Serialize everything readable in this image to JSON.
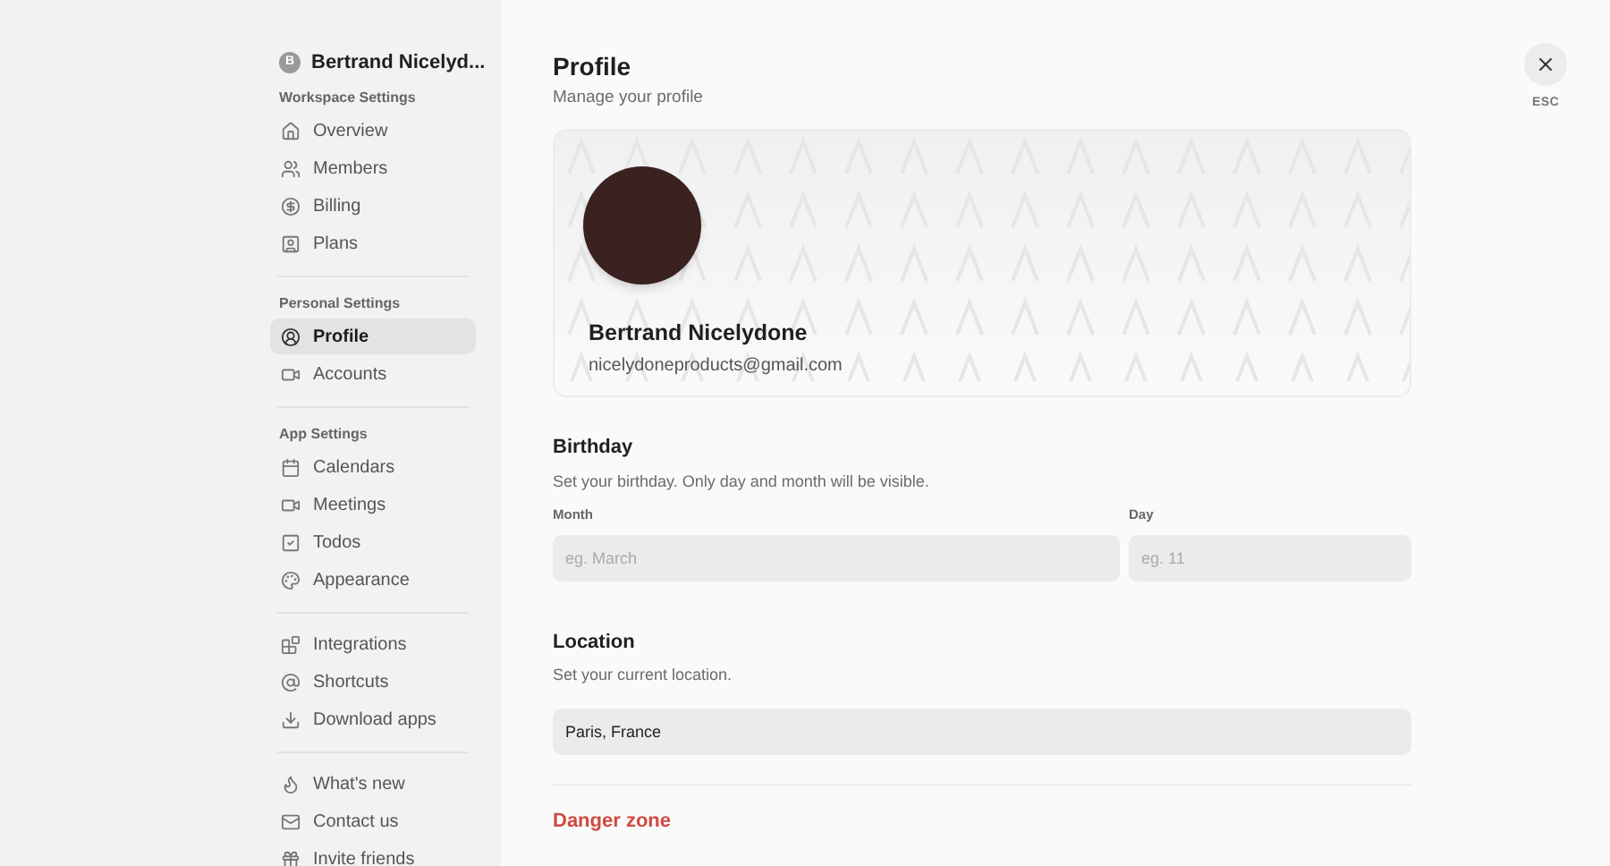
{
  "account_switcher": {
    "initial": "B",
    "name": "Bertrand Nicelyd..."
  },
  "sidebar": {
    "groups": [
      {
        "label": "Workspace Settings",
        "items": [
          {
            "label": "Overview",
            "selected": false
          },
          {
            "label": "Members",
            "selected": false
          },
          {
            "label": "Billing",
            "selected": false
          },
          {
            "label": "Plans",
            "selected": false
          }
        ]
      },
      {
        "label": "Personal Settings",
        "items": [
          {
            "label": "Profile",
            "selected": true
          },
          {
            "label": "Accounts",
            "selected": false
          }
        ]
      },
      {
        "label": "App Settings",
        "items": [
          {
            "label": "Calendars",
            "selected": false
          },
          {
            "label": "Meetings",
            "selected": false
          },
          {
            "label": "Todos",
            "selected": false
          },
          {
            "label": "Appearance",
            "selected": false
          }
        ]
      },
      {
        "items": [
          {
            "label": "Integrations",
            "selected": false
          },
          {
            "label": "Shortcuts",
            "selected": false
          },
          {
            "label": "Download apps",
            "selected": false
          }
        ]
      },
      {
        "items": [
          {
            "label": "What's new",
            "selected": false
          },
          {
            "label": "Contact us",
            "selected": false
          },
          {
            "label": "Invite friends",
            "selected": false
          }
        ]
      }
    ]
  },
  "header": {
    "title": "Profile",
    "subtitle": "Manage your profile",
    "close_hint": "ESC"
  },
  "profile_card": {
    "name": "Bertrand Nicelydone",
    "email": "nicelydoneproducts@gmail.com"
  },
  "birthday": {
    "title": "Birthday",
    "description": "Set your birthday. Only day and month will be visible.",
    "fields": [
      {
        "label": "Month",
        "placeholder": "eg. March"
      },
      {
        "label": "Day",
        "placeholder": "eg. 11"
      }
    ]
  },
  "location": {
    "title": "Location",
    "description": "Set your current location.",
    "value": "Paris, France"
  },
  "danger_zone": {
    "title": "Danger zone"
  }
}
